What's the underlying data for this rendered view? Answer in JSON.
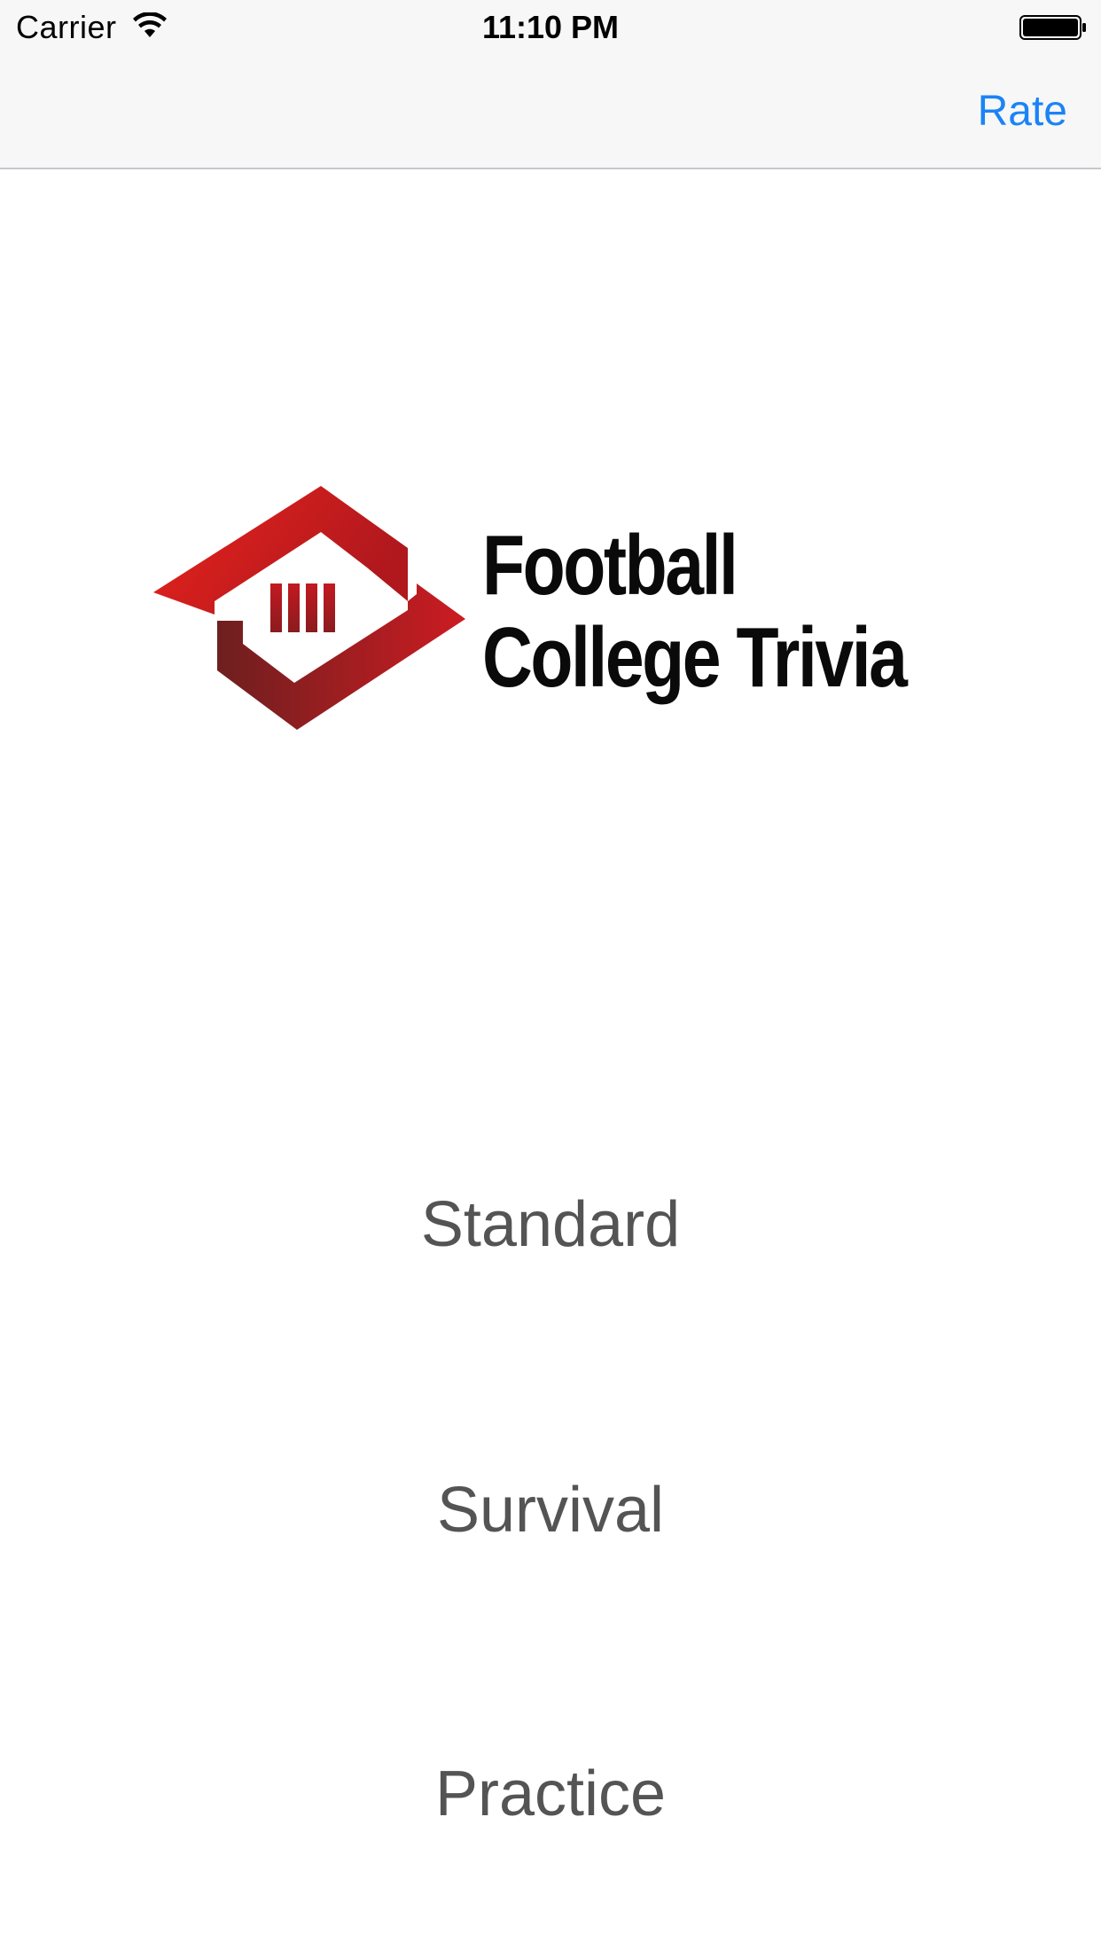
{
  "status_bar": {
    "carrier": "Carrier",
    "time": "11:10 PM",
    "wifi_icon": "wifi-icon",
    "battery_icon": "battery-icon"
  },
  "nav_bar": {
    "rate_label": "Rate",
    "accent_color": "#1a84f5"
  },
  "logo": {
    "line1": "Football",
    "line2": "College Trivia",
    "icon": "football-field-diamond-logo",
    "colors": [
      "#e11d1d",
      "#7a1f1f",
      "#0a0a0a"
    ]
  },
  "menu": {
    "items": [
      {
        "label": "Standard"
      },
      {
        "label": "Survival"
      },
      {
        "label": "Practice"
      }
    ],
    "text_color": "#545454"
  }
}
